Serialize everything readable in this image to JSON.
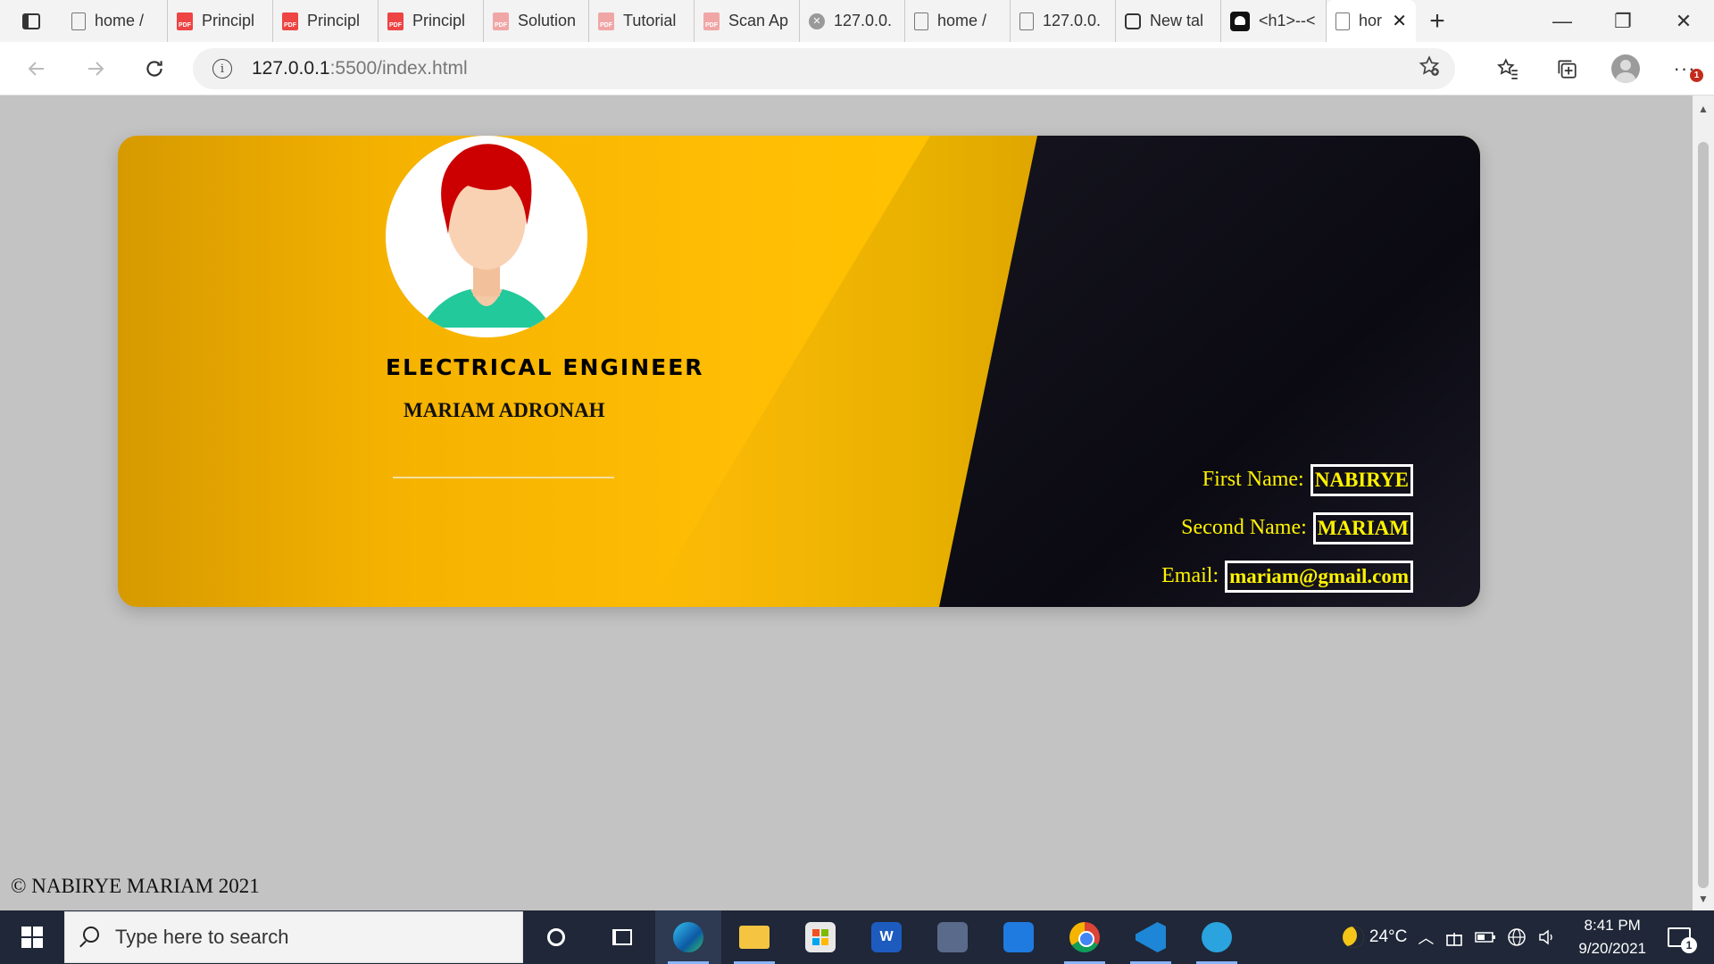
{
  "browser": {
    "tabs": [
      {
        "label": "home /",
        "icon": "document-icon"
      },
      {
        "label": "Principl",
        "icon": "pdf-icon"
      },
      {
        "label": "Principl",
        "icon": "pdf-icon"
      },
      {
        "label": "Principl",
        "icon": "pdf-icon"
      },
      {
        "label": "Solution",
        "icon": "pdf-icon"
      },
      {
        "label": "Tutorial",
        "icon": "pdf-icon"
      },
      {
        "label": "Scan Ap",
        "icon": "pdf-icon"
      },
      {
        "label": "127.0.0.",
        "icon": "error-globe-icon"
      },
      {
        "label": "home /",
        "icon": "document-icon"
      },
      {
        "label": "127.0.0.",
        "icon": "document-icon"
      },
      {
        "label": "New tal",
        "icon": "new-tab-icon"
      },
      {
        "label": "<h1>--<",
        "icon": "dark-app-icon"
      },
      {
        "label": "hor",
        "icon": "document-icon",
        "active": true
      }
    ],
    "close_tab": "✕",
    "new_tab": "+",
    "window_controls": {
      "minimize": "—",
      "restore": "❐",
      "close": "✕"
    },
    "address": {
      "host": "127.0.0.1",
      "path": ":5500/index.html"
    },
    "notification_count": "1"
  },
  "card": {
    "job_title": "ELECTRICAL ENGINEER",
    "name": "MARIAM ADRONAH",
    "fields": [
      {
        "label": "First Name:",
        "value": "NABIRYE"
      },
      {
        "label": "Second Name:",
        "value": "MARIAM"
      },
      {
        "label": "Email:",
        "value": "mariam@gmail.com"
      }
    ]
  },
  "footer": {
    "text": "© NABIRYE MARIAM 2021"
  },
  "taskbar": {
    "search_placeholder": "Type here to search",
    "temperature": "24°C",
    "time": "8:41 PM",
    "date": "9/20/2021",
    "notification_count": "1",
    "word_letter": "W"
  },
  "colors": {
    "card_gold": "#ffbd05",
    "card_dark": "#0e0d17",
    "info_text": "#fff200",
    "page_bg": "#c3c3c3"
  }
}
